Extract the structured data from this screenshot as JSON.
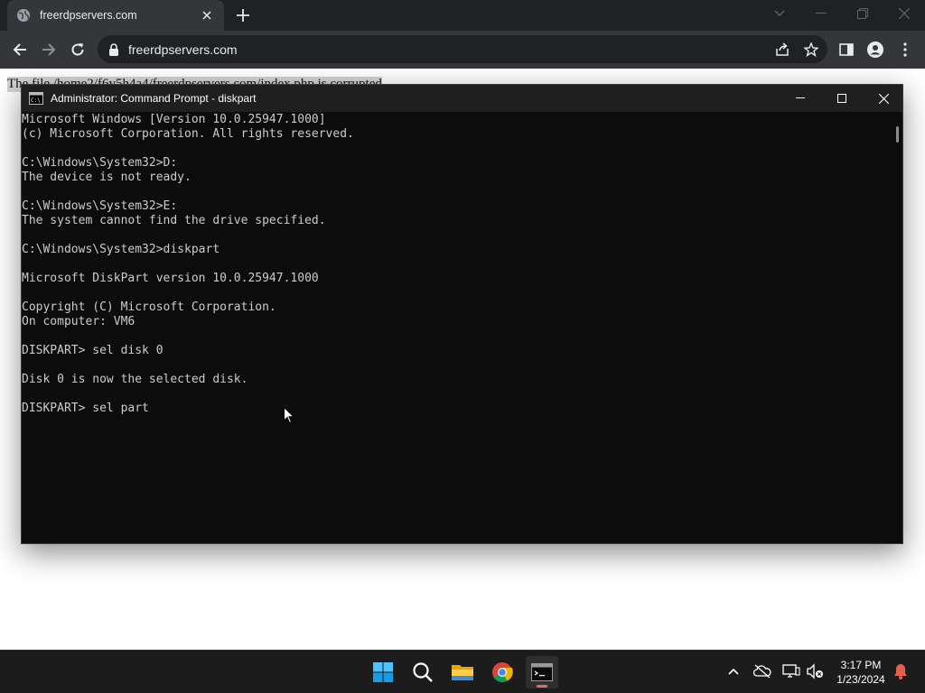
{
  "browser": {
    "tab_title": "freerdpservers.com",
    "address": "freerdpservers.com"
  },
  "page": {
    "text": "The file /home2/f6v5h4a4/freerdpservers.com/index.php is corrupted"
  },
  "cmd": {
    "title": "Administrator: Command Prompt - diskpart",
    "lines": [
      "Microsoft Windows [Version 10.0.25947.1000]",
      "(c) Microsoft Corporation. All rights reserved.",
      "",
      "C:\\Windows\\System32>D:",
      "The device is not ready.",
      "",
      "C:\\Windows\\System32>E:",
      "The system cannot find the drive specified.",
      "",
      "C:\\Windows\\System32>diskpart",
      "",
      "Microsoft DiskPart version 10.0.25947.1000",
      "",
      "Copyright (C) Microsoft Corporation.",
      "On computer: VM6",
      "",
      "DISKPART> sel disk 0",
      "",
      "Disk 0 is now the selected disk.",
      "",
      "DISKPART> sel part"
    ]
  },
  "taskbar": {
    "time": "3:17 PM",
    "date": "1/23/2024",
    "apps": [
      "start-icon",
      "search-icon",
      "file-explorer-icon",
      "chrome-icon",
      "terminal-icon"
    ]
  },
  "colors": {
    "console_bg": "#0c0c0c",
    "console_text": "#cccccc",
    "chrome_dark": "#202124",
    "chrome_toolbar": "#35363a",
    "taskbar": "#1c1c1c",
    "notification_bell": "#e8604c"
  }
}
